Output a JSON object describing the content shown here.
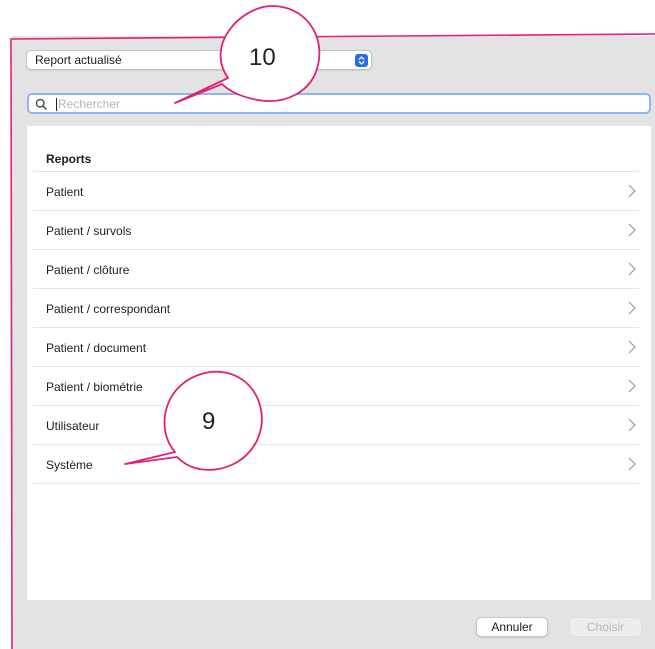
{
  "header": {
    "report_type": {
      "selected": "Report actualisé",
      "icon": "updown-stepper-icon",
      "accent": "#2a6de9"
    }
  },
  "search": {
    "placeholder": "Rechercher",
    "value": "",
    "icon": "search-icon",
    "focus_ring": "#8fb4f0"
  },
  "list": {
    "section_title": "Reports",
    "items": [
      {
        "label": "Patient"
      },
      {
        "label": "Patient / survols"
      },
      {
        "label": "Patient / clôture"
      },
      {
        "label": "Patient / correspondant"
      },
      {
        "label": "Patient / document"
      },
      {
        "label": "Patient / biométrie"
      },
      {
        "label": "Utilisateur"
      },
      {
        "label": "Système"
      }
    ]
  },
  "footer": {
    "cancel_label": "Annuler",
    "choose_label": "Choisir"
  },
  "annotations": {
    "color": "#e0207a",
    "callouts": [
      {
        "number": "10"
      },
      {
        "number": "9"
      }
    ]
  }
}
